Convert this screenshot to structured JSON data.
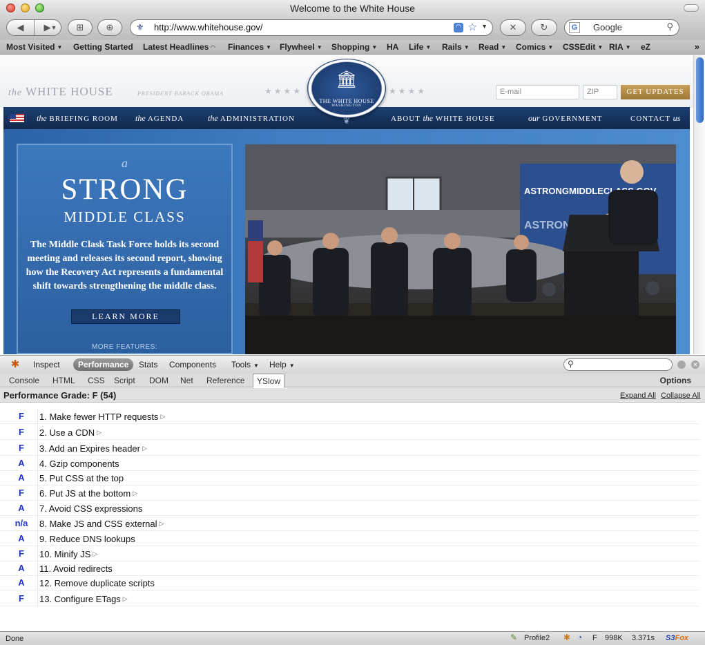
{
  "window": {
    "title": "Welcome to the White House"
  },
  "toolbar": {
    "url": "http://www.whitehouse.gov/",
    "search_placeholder": "Google",
    "icons": [
      "back-icon",
      "forward-icon",
      "new-tab-icon",
      "bookmark-icon",
      "rss-icon",
      "star-icon",
      "stop-icon",
      "reload-icon",
      "search-icon"
    ]
  },
  "bookmarks": [
    {
      "label": "Most Visited",
      "menu": true
    },
    {
      "label": "Getting Started",
      "menu": false
    },
    {
      "label": "Latest Headlines",
      "menu": false,
      "rss": true
    },
    {
      "label": "Finances",
      "menu": true
    },
    {
      "label": "Flywheel",
      "menu": true
    },
    {
      "label": "Shopping",
      "menu": true
    },
    {
      "label": "HA",
      "menu": false
    },
    {
      "label": "Life",
      "menu": true
    },
    {
      "label": "Rails",
      "menu": true
    },
    {
      "label": "Read",
      "menu": true
    },
    {
      "label": "Comics",
      "menu": true
    },
    {
      "label": "CSSEdit",
      "menu": true
    },
    {
      "label": "RIA",
      "menu": true
    },
    {
      "label": "eZ",
      "menu": false
    }
  ],
  "site": {
    "wordmark_the": "the",
    "wordmark": "WHITE HOUSE",
    "tagline": "PRESIDENT BARACK OBAMA",
    "seal_title": "THE WHITE HOUSE",
    "seal_sub": "WASHINGTON",
    "email_placeholder": "E-mail",
    "zip_placeholder": "ZIP",
    "updates_button": "GET UPDATES",
    "nav": [
      {
        "prefix": "the",
        "label": "BRIEFING ROOM"
      },
      {
        "prefix": "the",
        "label": "AGENDA"
      },
      {
        "prefix": "the",
        "label": "ADMINISTRATION"
      },
      {
        "prefix": "",
        "label": "ABOUT",
        "mid": "the",
        "suffix": "WHITE HOUSE"
      },
      {
        "prefix": "our",
        "label": "GOVERNMENT"
      },
      {
        "prefix": "",
        "label": "CONTACT",
        "suffix_i": "us"
      }
    ],
    "feature": {
      "a": "a",
      "strong": "STRONG",
      "middle": "MIDDLE CLASS",
      "body": "The Middle Clask Task Force holds its second meeting and releases its second report, showing how the Recovery Act represents a fundamental shift towards strengthening the middle class.",
      "button": "LEARN MORE",
      "more": "MORE FEATURES:"
    },
    "photo_banner": "ASTRONGMIDDLECLASS.GOV"
  },
  "firebug": {
    "inspect": "Inspect",
    "performance": "Performance",
    "stats": "Stats",
    "components": "Components",
    "tools": "Tools",
    "help": "Help",
    "tabs": [
      "Console",
      "HTML",
      "CSS",
      "Script",
      "DOM",
      "Net",
      "Reference",
      "YSlow"
    ],
    "options": "Options"
  },
  "yslow": {
    "grade_title": "Performance Grade: F (54)",
    "expand_all": "Expand All",
    "collapse_all": "Collapse All",
    "rules": [
      {
        "grade": "F",
        "text": "1. Make fewer HTTP requests",
        "expandable": true
      },
      {
        "grade": "F",
        "text": "2. Use a CDN",
        "expandable": true
      },
      {
        "grade": "F",
        "text": "3. Add an Expires header",
        "expandable": true
      },
      {
        "grade": "A",
        "text": "4. Gzip components",
        "expandable": false
      },
      {
        "grade": "A",
        "text": "5. Put CSS at the top",
        "expandable": false
      },
      {
        "grade": "F",
        "text": "6. Put JS at the bottom",
        "expandable": true
      },
      {
        "grade": "A",
        "text": "7. Avoid CSS expressions",
        "expandable": false
      },
      {
        "grade": "n/a",
        "text": "8. Make JS and CSS external",
        "expandable": true
      },
      {
        "grade": "A",
        "text": "9. Reduce DNS lookups",
        "expandable": false
      },
      {
        "grade": "F",
        "text": "10. Minify JS",
        "expandable": true
      },
      {
        "grade": "A",
        "text": "11. Avoid redirects",
        "expandable": false
      },
      {
        "grade": "A",
        "text": "12. Remove duplicate scripts",
        "expandable": false
      },
      {
        "grade": "F",
        "text": "13. Configure ETags",
        "expandable": true
      }
    ]
  },
  "status": {
    "text": "Done",
    "profile": "Profile2",
    "grade": "F",
    "size": "998K",
    "time": "3.371s",
    "s3fox_a": "S3",
    "s3fox_b": "Fox"
  },
  "colors": {
    "grade_blue": "#2233cc",
    "nav_blue": "#1d3f72",
    "accent_gold": "#b08845"
  }
}
